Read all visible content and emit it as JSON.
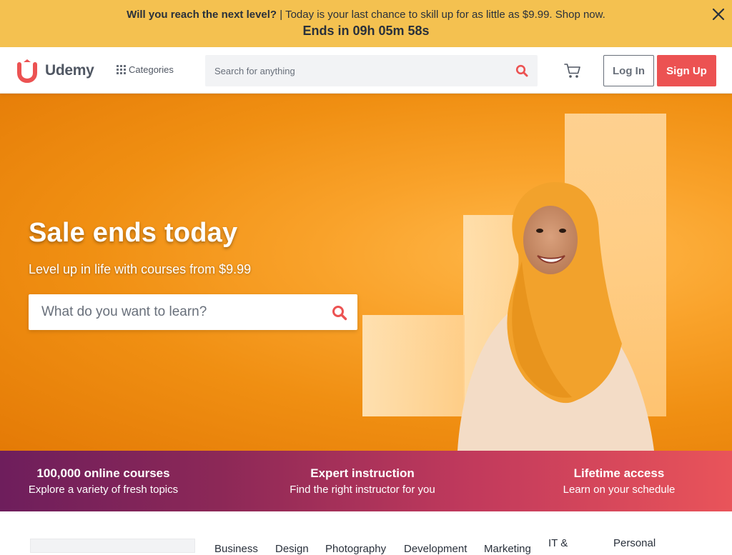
{
  "promo": {
    "headline": "Will you reach the next level?",
    "message": " | Today is your last chance to skill up for as little as $9.99. Shop now.",
    "countdown": "Ends in 09h 05m 58s"
  },
  "header": {
    "logo_text": "Udemy",
    "categories_label": "Categories",
    "search_placeholder": "Search for anything",
    "login_label": "Log In",
    "signup_label": "Sign Up"
  },
  "hero": {
    "title": "Sale ends today",
    "subtitle": "Level up in life with courses from $9.99",
    "search_placeholder": "What do you want to learn?"
  },
  "value_props": [
    {
      "title": "100,000 online courses",
      "description": "Explore a variety of fresh topics"
    },
    {
      "title": "Expert instruction",
      "description": "Find the right instructor for you"
    },
    {
      "title": "Lifetime access",
      "description": "Learn on your schedule"
    }
  ],
  "category_tabs": [
    "Business",
    "Design",
    "Photography",
    "Development",
    "Marketing",
    "IT &",
    "Personal"
  ],
  "colors": {
    "brand_red": "#ec5252",
    "promo_yellow": "#f4c150",
    "hero_orange": "#f08f12",
    "band_start": "#6e1e5c",
    "band_end": "#e9545a"
  }
}
